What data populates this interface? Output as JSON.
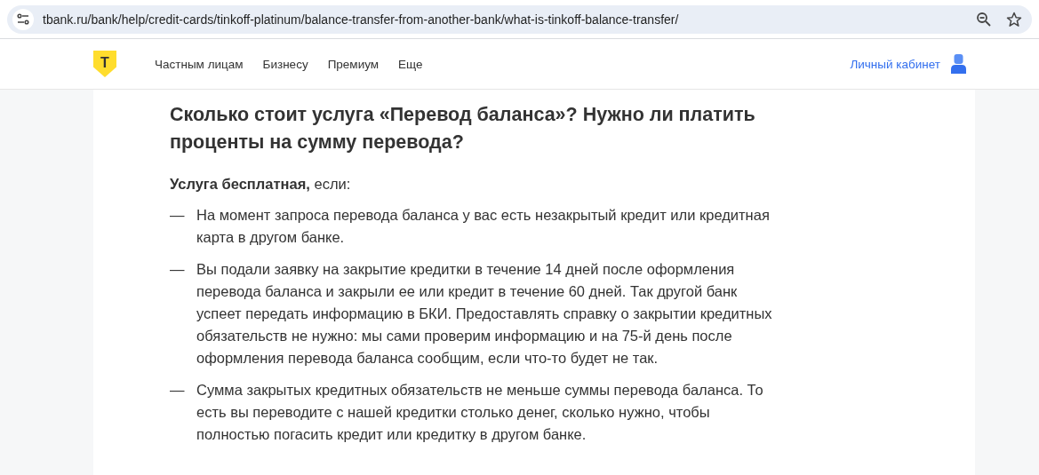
{
  "browser": {
    "url": "tbank.ru/bank/help/credit-cards/tinkoff-platinum/balance-transfer-from-another-bank/what-is-tinkoff-balance-transfer/"
  },
  "header": {
    "logo_letter": "Т",
    "nav": [
      "Частным лицам",
      "Бизнесу",
      "Премиум",
      "Еще"
    ],
    "account_link": "Личный кабинет"
  },
  "article": {
    "heading": "Сколько стоит услуга «Перевод баланса»? Нужно ли платить проценты на сумму перевода?",
    "intro": "**Услуга бесплатная,** если:",
    "items": [
      {
        "bullet": "—",
        "text": "На момент запроса перевода баланса у вас есть незакрытый кредит или кредитная карта в другом банке."
      },
      {
        "bullet": "—",
        "text": "Вы подали заявку на закрытие кредитки в течение 14 дней после оформления перевода баланса и закрыли ее или кредит в течение 60 дней. Так другой банк успеет передать информацию в БКИ. Предоставлять справку о закрытии кредитных обязательств не нужно: мы сами проверим информацию и на 75-й день после оформления перевода баланса сообщим, если что-то будет не так."
      },
      {
        "bullet": "—",
        "text": "Сумма закрытых кредитных обязательств не меньше суммы перевода баланса. То есть вы переводите с нашей кредитки столько денег, сколько нужно, чтобы полностью погасить кредит или кредитку в другом банке."
      }
    ]
  }
}
